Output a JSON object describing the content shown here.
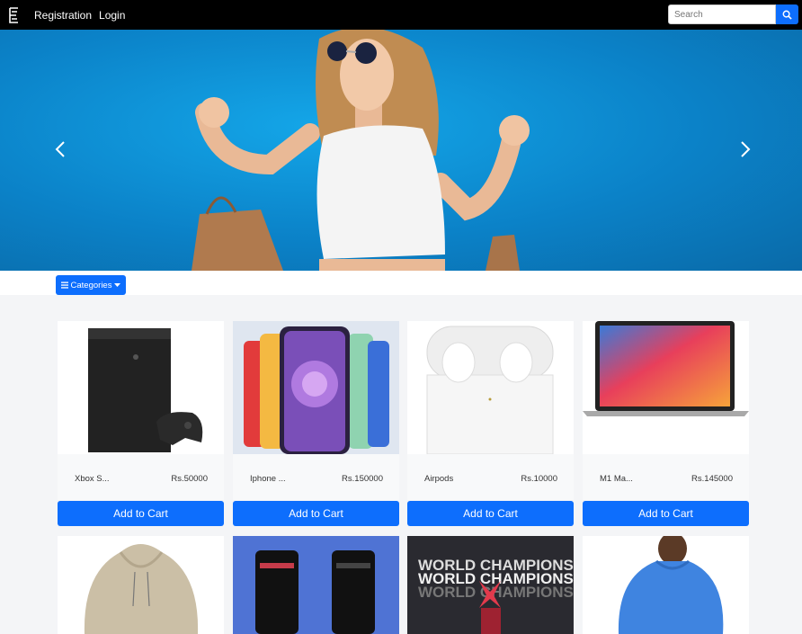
{
  "navbar": {
    "logo_icon": "e-logo-icon",
    "links": [
      "Registration",
      "Login"
    ],
    "search_placeholder": "Search",
    "search_icon": "search-icon",
    "accent": "#0d6efd"
  },
  "hero": {
    "prev_icon": "chevron-left-icon",
    "next_icon": "chevron-right-icon"
  },
  "categories": {
    "label": "Categories",
    "icon": "menu-icon",
    "caret": "caret-down-icon"
  },
  "products": [
    {
      "name": "Xbox S...",
      "price": "Rs.50000",
      "cta": "Add to Cart"
    },
    {
      "name": "Iphone ...",
      "price": "Rs.150000",
      "cta": "Add to Cart"
    },
    {
      "name": "Airpods",
      "price": "Rs.10000",
      "cta": "Add to Cart"
    },
    {
      "name": "M1 Ma...",
      "price": "Rs.145000",
      "cta": "Add to Cart"
    }
  ],
  "products_row2": [
    {
      "image": "hoodie"
    },
    {
      "image": "phones"
    },
    {
      "image": "world-champions-poster",
      "poster_text": [
        "WORLD CHAMPIONS",
        "WORLD CHAMPIONS",
        "WORLD CHAMPIONS"
      ]
    },
    {
      "image": "blue-hoodie-model"
    }
  ]
}
